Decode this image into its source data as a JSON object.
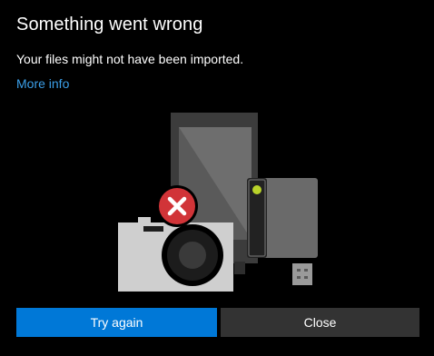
{
  "dialog": {
    "title": "Something went wrong",
    "message": "Your files might not have been imported.",
    "more_info_link": "More info"
  },
  "buttons": {
    "primary_label": "Try again",
    "secondary_label": "Close"
  },
  "illustration": {
    "icons": [
      "tablet-icon",
      "usb-drive-icon",
      "camera-icon",
      "error-badge-icon"
    ]
  },
  "colors": {
    "background": "#000000",
    "accent": "#0078d7",
    "link": "#3b9fe8",
    "error": "#d13438",
    "secondary_button": "#333333"
  }
}
